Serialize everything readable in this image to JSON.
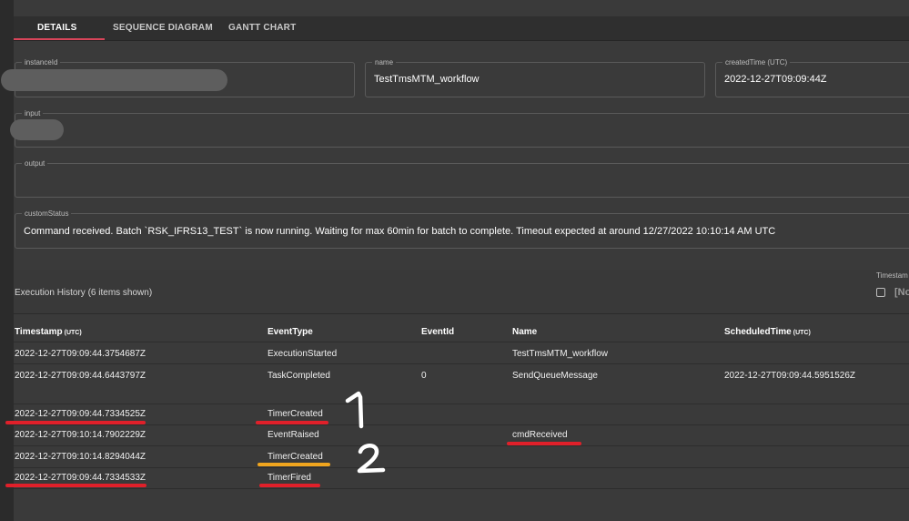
{
  "tabs": [
    {
      "label": "DETAILS"
    },
    {
      "label": "SEQUENCE DIAGRAM"
    },
    {
      "label": "GANTT CHART"
    }
  ],
  "fields": {
    "instance_id": {
      "label": "instanceId",
      "value": ""
    },
    "name": {
      "label": "name",
      "value": "TestTmsMTM_workflow"
    },
    "created_time": {
      "label": "createdTime (UTC)",
      "value": "2022-12-27T09:09:44Z"
    },
    "input": {
      "label": "input",
      "value": ""
    },
    "output": {
      "label": "output",
      "value": ""
    },
    "custom_status": {
      "label": "customStatus",
      "value": "Command received. Batch `RSK_IFRS13_TEST` is now running. Waiting for max 60min for batch to complete. Timeout expected at around 12/27/2022 10:10:14 AM UTC"
    }
  },
  "history": {
    "title": "Execution History (6 items shown)",
    "timestamp_filter_label": "Timestam",
    "timestamp_filter_value": "[No",
    "columns": {
      "timestamp": "Timestamp",
      "timestamp_unit": "(UTC)",
      "event_type": "EventType",
      "event_id": "EventId",
      "name": "Name",
      "scheduled_time": "ScheduledTime",
      "scheduled_unit": "(UTC)"
    },
    "rows": [
      {
        "timestamp": "2022-12-27T09:09:44.3754687Z",
        "event_type": "ExecutionStarted",
        "event_id": "",
        "name": "TestTmsMTM_workflow",
        "scheduled_time": ""
      },
      {
        "timestamp": "2022-12-27T09:09:44.6443797Z",
        "event_type": "TaskCompleted",
        "event_id": "0",
        "name": "SendQueueMessage",
        "scheduled_time": "2022-12-27T09:09:44.5951526Z"
      },
      {
        "timestamp": "2022-12-27T09:09:44.7334525Z",
        "event_type": "TimerCreated",
        "event_id": "",
        "name": "",
        "scheduled_time": ""
      },
      {
        "timestamp": "2022-12-27T09:10:14.7902229Z",
        "event_type": "EventRaised",
        "event_id": "",
        "name": "cmdReceived",
        "scheduled_time": ""
      },
      {
        "timestamp": "2022-12-27T09:10:14.8294044Z",
        "event_type": "TimerCreated",
        "event_id": "",
        "name": "",
        "scheduled_time": ""
      },
      {
        "timestamp": "2022-12-27T09:09:44.7334533Z",
        "event_type": "TimerFired",
        "event_id": "",
        "name": "",
        "scheduled_time": ""
      }
    ]
  },
  "annotations": {
    "number_1": "1",
    "number_2": "2",
    "underline_colors": {
      "red": "#e0202a",
      "orange": "#f0a51e"
    }
  },
  "colors": {
    "accent_tab": "#d8455a",
    "background": "#3a3a3a"
  }
}
